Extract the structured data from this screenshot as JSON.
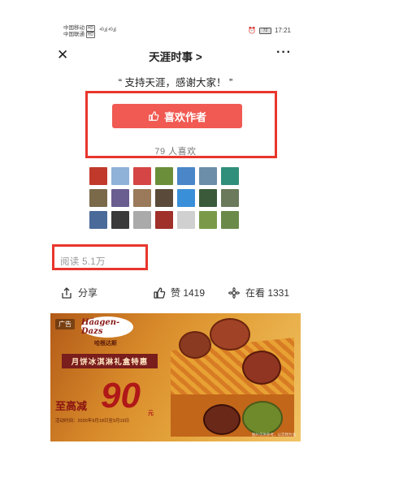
{
  "status_bar": {
    "carrier1": "中国移动",
    "carrier1_tag": "HD",
    "carrier2": "中国联通",
    "carrier2_tag": "HD",
    "signal": "⁴ᴳ.ıl ⁴ᴳ.ıl",
    "battery": "72",
    "time": "17:21"
  },
  "nav": {
    "title": "天涯时事 >",
    "close_icon": "close-icon",
    "more_icon": "more-icon"
  },
  "quote": "“ 支持天涯，感谢大家！ ”",
  "like_button": {
    "label": "喜欢作者",
    "icon": "thumbs-up-icon",
    "color": "#f05a52"
  },
  "likes_count": "79 人喜欢",
  "avatars": [
    "#c0392b",
    "#8fb2d9",
    "#d64545",
    "#6b8e3a",
    "#4a86c8",
    "#6c8ea8",
    "#2f8f7a",
    "",
    "#7a6a4a",
    "#6a5d8f",
    "#9a7a5a",
    "#5a4a3a",
    "#3a8fd9",
    "#3a5a3a",
    "#6a7a5a",
    "",
    "#4a6a9a",
    "#3a3a3a",
    "#aaaaaa",
    "#a0302a",
    "#d0d0d0",
    "#7a9a4a",
    "#6a8a4a",
    ""
  ],
  "read_count": "阅读 5.1万",
  "actions": {
    "share_label": "分享",
    "share_icon": "share-icon",
    "zan_label": "赞 1419",
    "zan_icon": "thumbs-up-icon",
    "view_label": "在看 1331",
    "view_icon": "flower-icon"
  },
  "ad": {
    "tag": "广告",
    "brand": "Häagen-Dazs",
    "brand_sub": "哈根达斯",
    "banner": "月饼冰淇淋礼盒特惠",
    "save_label": "至高减",
    "amount": "90",
    "unit": "元",
    "date": "活动时间：2020年9月18日至9月19日",
    "note": "图片仅供参考，以实物为准"
  },
  "highlight_color": "#e8362c"
}
